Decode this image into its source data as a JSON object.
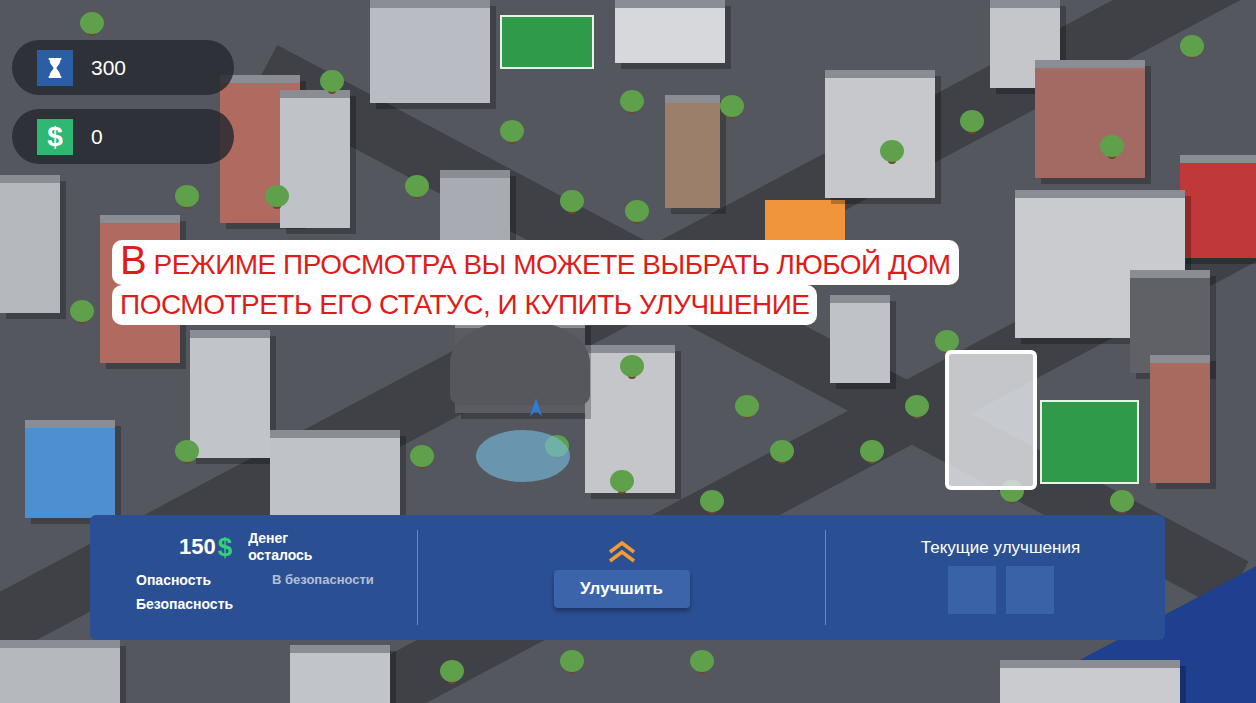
{
  "hud": {
    "time": {
      "value": "300"
    },
    "money": {
      "icon": "$",
      "value": "0"
    }
  },
  "caption": {
    "lines": [
      "В РЕЖИМЕ ПРОСМОТРА ВЫ МОЖЕТЕ ВЫБРАТЬ ЛЮБОЙ ДОМ",
      "ПОСМОТРЕТЬ ЕГО СТАТУС, И КУПИТЬ УЛУЧШЕНИЕ"
    ]
  },
  "panel": {
    "money_left": {
      "amount": "150",
      "currency": "$",
      "label": "Денег осталось"
    },
    "stats": [
      {
        "label": "Опасность",
        "value": "В безопасности"
      },
      {
        "label": "Безопасность"
      }
    ],
    "upgrade_button": "Улучшить",
    "current_upgrades": {
      "title": "Текущие улучшения",
      "slots": [
        {
          "filled": false
        },
        {
          "filled": false
        }
      ]
    }
  }
}
